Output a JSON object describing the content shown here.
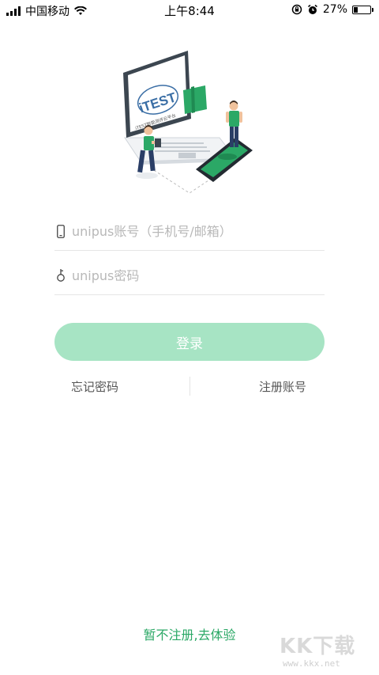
{
  "status_bar": {
    "carrier": "中国移动",
    "time": "上午8:44",
    "battery": "27%",
    "battery_level": 0.27
  },
  "illustration": {
    "screen_text": "iTEST",
    "screen_subtext": "iTEST智能测评云平台"
  },
  "form": {
    "account_placeholder": "unipus账号（手机号/邮箱）",
    "password_placeholder": "unipus密码",
    "login_label": "登录"
  },
  "links": {
    "forgot_password": "忘记密码",
    "register": "注册账号"
  },
  "trial_link": "暂不注册,去体验",
  "watermark": {
    "brand": "KK下载",
    "url": "www.kkx.net"
  },
  "colors": {
    "accent": "#2ba866",
    "button_disabled": "#a7e4c4"
  }
}
